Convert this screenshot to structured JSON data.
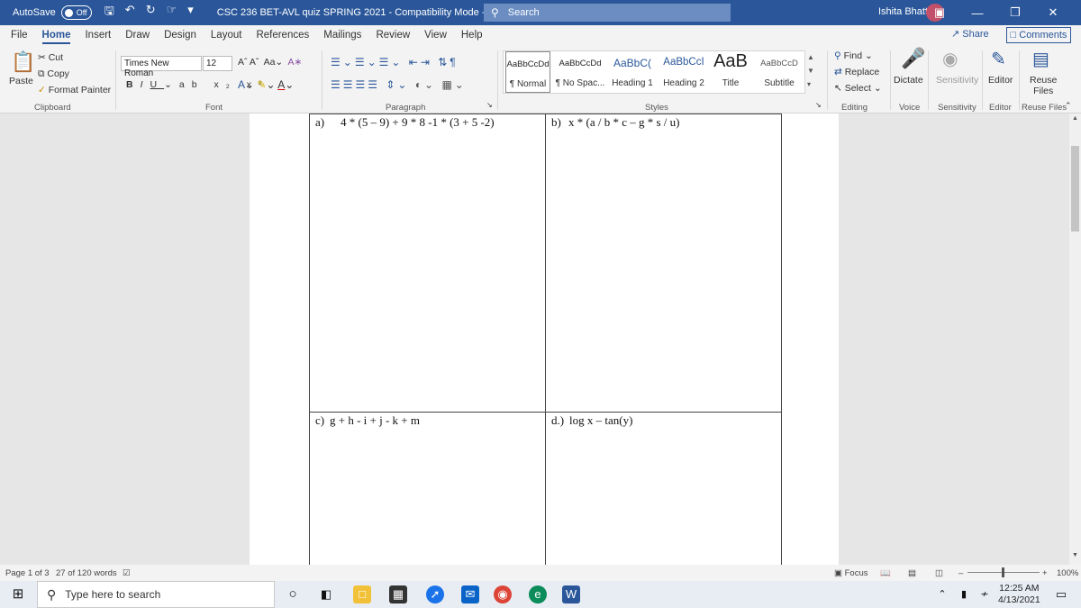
{
  "titlebar": {
    "autosave_label": "AutoSave",
    "autosave_state": "Off",
    "doc_title": "CSC 236 BET-AVL quiz SPRING 2021  -  Compatibility Mode  -  Word",
    "search_placeholder": "Search",
    "user_name": "Ishita Bhatt"
  },
  "tabs": [
    "File",
    "Home",
    "Insert",
    "Draw",
    "Design",
    "Layout",
    "References",
    "Mailings",
    "Review",
    "View",
    "Help"
  ],
  "actions": {
    "share": "Share",
    "comments": "Comments"
  },
  "ribbon": {
    "clipboard": {
      "paste": "Paste",
      "cut": "Cut",
      "copy": "Copy",
      "format_painter": "Format Painter",
      "label": "Clipboard"
    },
    "font": {
      "name": "Times New Roman",
      "size": "12",
      "label": "Font"
    },
    "paragraph": {
      "label": "Paragraph"
    },
    "styles": {
      "label": "Styles",
      "items": [
        {
          "sample": "AaBbCcDd",
          "name": "¶ Normal"
        },
        {
          "sample": "AaBbCcDd",
          "name": "¶ No Spac..."
        },
        {
          "sample": "AaBbC(",
          "name": "Heading 1"
        },
        {
          "sample": "AaBbCcI",
          "name": "Heading 2"
        },
        {
          "sample": "AaB",
          "name": "Title"
        },
        {
          "sample": "AaBbCcD",
          "name": "Subtitle"
        }
      ]
    },
    "editing": {
      "find": "Find",
      "replace": "Replace",
      "select": "Select",
      "label": "Editing"
    },
    "voice": {
      "dictate": "Dictate",
      "label": "Voice"
    },
    "sensitivity": {
      "button": "Sensitivity",
      "label": "Sensitivity"
    },
    "editor": {
      "button": "Editor",
      "label": "Editor"
    },
    "reuse": {
      "button_line1": "Reuse",
      "button_line2": "Files",
      "label": "Reuse Files"
    }
  },
  "document": {
    "cells": [
      {
        "letter": "a)",
        "expr": "4 * (5 – 9) + 9 * 8 -1 * (3 + 5 -2)"
      },
      {
        "letter": "b)",
        "expr": "x * (a / b * c – g * s / u)"
      },
      {
        "letter": "c)",
        "expr": "g + h - i + j - k + m"
      },
      {
        "letter": "d.)",
        "expr": "log x – tan(y)"
      }
    ]
  },
  "status": {
    "page": "Page 1 of 3",
    "words": "27 of 120 words",
    "focus": "Focus",
    "zoom": "100%"
  },
  "taskbar": {
    "search_placeholder": "Type here to search",
    "time": "12:25 AM",
    "date": "4/13/2021"
  },
  "colors": {
    "word_blue": "#2b579a"
  }
}
